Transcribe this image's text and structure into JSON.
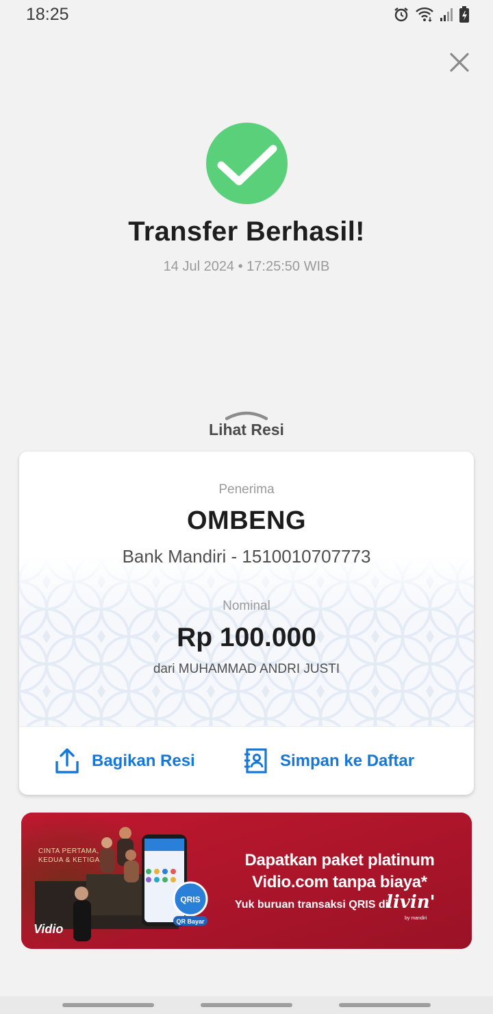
{
  "status_bar": {
    "time": "18:25"
  },
  "header": {
    "title": "Transfer Berhasil!",
    "datetime": "14 Jul 2024 • 17:25:50 WIB"
  },
  "receipt_toggle": {
    "label": "Lihat Resi"
  },
  "receipt": {
    "recipient_label": "Penerima",
    "recipient_name": "OMBENG",
    "recipient_bank": "Bank Mandiri - 1510010707773",
    "amount_label": "Nominal",
    "amount": "Rp 100.000",
    "sender": "dari MUHAMMAD ANDRI JUSTI"
  },
  "actions": {
    "share_label": "Bagikan Resi",
    "save_label": "Simpan ke Daftar"
  },
  "banner": {
    "tagline": "CINTA PERTAMA, KEDUA & KETIGA",
    "logo": "Vidio",
    "headline_1": "Dapatkan paket platinum",
    "headline_2": "Vidio.com tanpa biaya*",
    "subline": "Yuk buruan transaksi QRIS di",
    "brand": "livin'",
    "brand_sub": "by mandiri"
  },
  "colors": {
    "success": "#5bd07b",
    "accent": "#1578d8",
    "banner": "#b0182c"
  }
}
